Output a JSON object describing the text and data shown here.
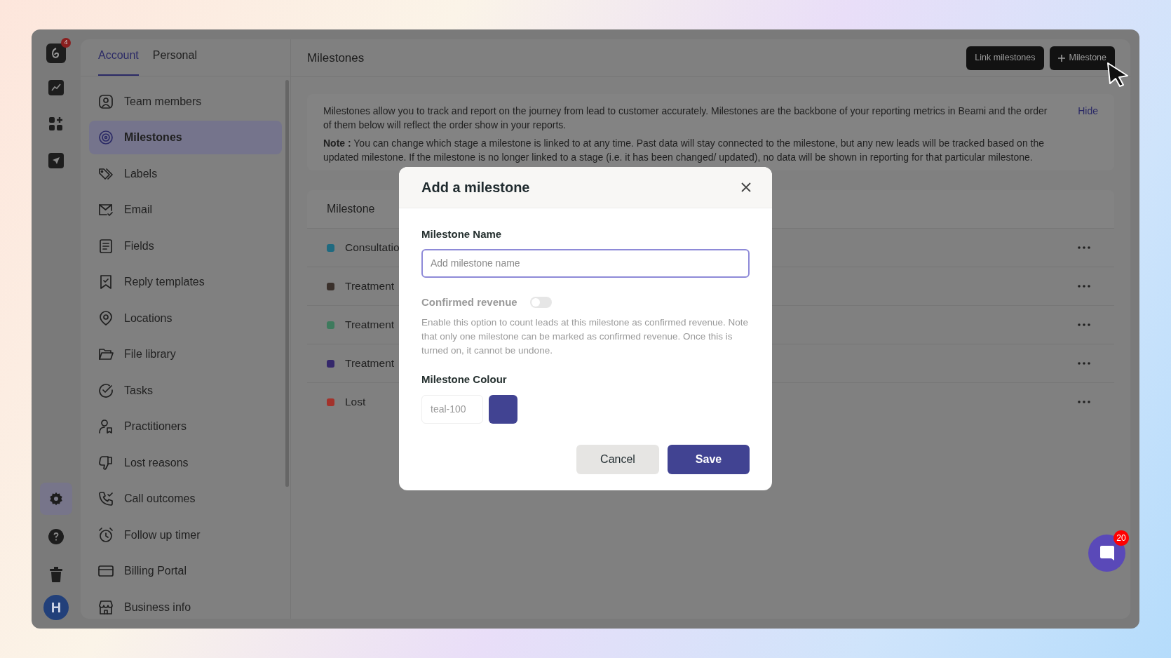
{
  "rail": {
    "logo_badge": "4",
    "items": [
      {
        "kind": "chart",
        "selected": false
      },
      {
        "kind": "apps",
        "selected": false
      },
      {
        "kind": "send",
        "selected": false
      },
      {
        "kind": "settings",
        "selected": true
      },
      {
        "kind": "help",
        "selected": false
      },
      {
        "kind": "trash",
        "selected": false
      }
    ],
    "avatar": "H"
  },
  "settings_tabs": [
    {
      "label": "Account",
      "selected": true
    },
    {
      "label": "Personal",
      "selected": false
    }
  ],
  "settings_menu": [
    {
      "kind": "user",
      "label": "Team members",
      "selected": false
    },
    {
      "kind": "target",
      "label": "Milestones",
      "selected": true
    },
    {
      "kind": "tag",
      "label": "Labels",
      "selected": false
    },
    {
      "kind": "mail",
      "label": "Email",
      "selected": false
    },
    {
      "kind": "doc",
      "label": "Fields",
      "selected": false
    },
    {
      "kind": "bookmark",
      "label": "Reply templates",
      "selected": false
    },
    {
      "kind": "pin",
      "label": "Locations",
      "selected": false
    },
    {
      "kind": "folder",
      "label": "File library",
      "selected": false
    },
    {
      "kind": "check",
      "label": "Tasks",
      "selected": false
    },
    {
      "kind": "person",
      "label": "Practitioners",
      "selected": false
    },
    {
      "kind": "thumbdown",
      "label": "Lost reasons",
      "selected": false
    },
    {
      "kind": "phone",
      "label": "Call outcomes",
      "selected": false
    },
    {
      "kind": "alarm",
      "label": "Follow up timer",
      "selected": false
    },
    {
      "kind": "card",
      "label": "Billing Portal",
      "selected": false
    },
    {
      "kind": "store",
      "label": "Business info",
      "selected": false
    }
  ],
  "main": {
    "title": "Milestones",
    "buttons": [
      {
        "kind": "plain",
        "label": "Link milestones"
      },
      {
        "kind": "add",
        "label": "Milestone"
      }
    ],
    "info": {
      "text": "Milestones allow you to track and report on the journey from lead to customer accurately. Milestones are the backbone of your reporting metrics in Beami and the order of them below will reflect the order show in your reports.",
      "note": "**Note :** You can change which stage a milestone is linked to at any time. Past data will stay connected to the milestone, but any new leads will be tracked based on the updated milestone. If the milestone is no longer linked to a stage (i.e. it has been changed/ updated), no data will be shown in reporting for that particular milestone.",
      "hide": "Hide"
    },
    "table": {
      "column": "Milestone",
      "rows": [
        {
          "name": "Consultatio",
          "color": "#1f6a80"
        },
        {
          "name": "Treatment",
          "color": "#3a302b"
        },
        {
          "name": "Treatment",
          "color": "#3e7a5d"
        },
        {
          "name": "Treatment",
          "color": "#35286b"
        },
        {
          "name": "Lost",
          "color": "#a3322b"
        }
      ]
    }
  },
  "modal": {
    "title": "Add a milestone",
    "name_label": "Milestone Name",
    "name_placeholder": "Add milestone name",
    "revenue_label": "Confirmed revenue",
    "revenue_on": false,
    "revenue_help": "Enable this option to count leads at this milestone as confirmed revenue. Note that only one milestone can be marked as confirmed revenue. Once this is turned on, it cannot be undone.",
    "colour_label": "Milestone Colour",
    "colour_value": "teal-100",
    "cancel": "Cancel",
    "save": "Save"
  },
  "chat": {
    "badge": "20"
  }
}
